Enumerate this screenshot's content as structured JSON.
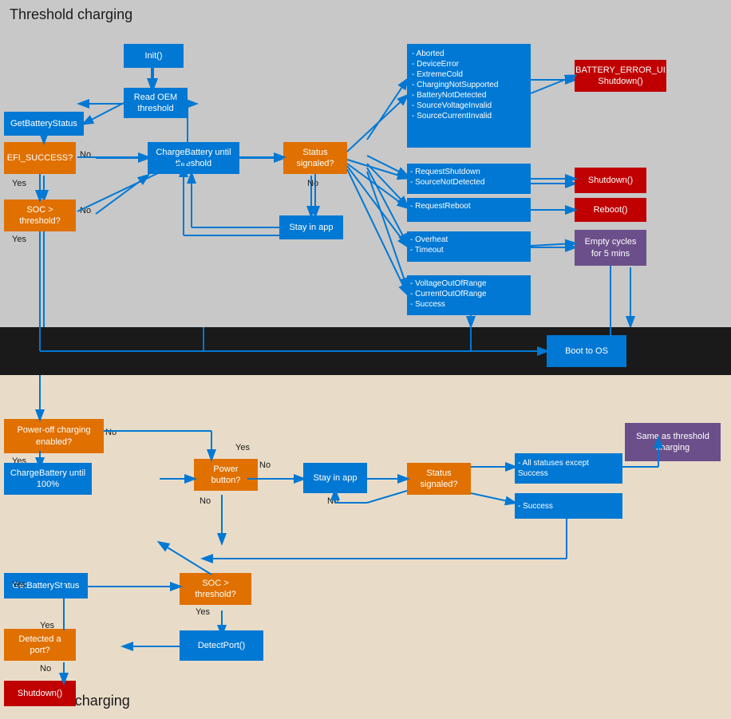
{
  "sections": {
    "top_title": "Threshold charging",
    "bottom_title": "Power-off charging"
  },
  "top_boxes": {
    "init": "Init()",
    "get_battery_status": "GetBatteryStatus",
    "read_oem": "Read OEM threshold",
    "efi_success": "EFI_SUCCESS?",
    "charge_battery_threshold": "ChargeBattery until threshold",
    "status_signaled": "Status signaled?",
    "stay_in_app_top": "Stay in app",
    "soc_threshold": "SOC > threshold?",
    "battery_error": "BATTERY_ERROR_UI Shutdown()",
    "shutdown": "Shutdown()",
    "reboot": "Reboot()",
    "empty_cycles": "Empty cycles for 5 mins",
    "aborted_group": "- Aborted\n- DeviceError\n- ExtremeCold\n- ChargingNotSupported\n- BatteryNotDetected\n- SourceVoltageInvalid\n- SourceCurrentInvalid",
    "request_shutdown": "- RequestShutdown\n- SourceNotDetected",
    "request_reboot": "- RequestReboot",
    "overheat_group": "- Overheat\n- Timeout",
    "voltage_group": "- VoltageOutOfRange\n- CurrentOutOfRange\n- Success"
  },
  "middle_boxes": {
    "boot_to_os": "Boot to OS"
  },
  "bottom_boxes": {
    "power_off_charging": "Power-off charging enabled?",
    "charge_battery_100": "ChargeBattery until 100%",
    "power_button": "Power button?",
    "stay_in_app_bot": "Stay in app",
    "status_signaled_bot": "Status signaled?",
    "get_battery_status_bot": "GetBatteryStatus",
    "soc_threshold_bot": "SOC > threshold?",
    "detected_port": "Detected a port?",
    "detect_port": "DetectPort()",
    "shutdown_bot": "Shutdown()",
    "all_statuses": "- All statuses except Success",
    "success": "- Success",
    "same_as_threshold": "Same as threshold charging"
  },
  "labels": {
    "no": "No",
    "yes": "Yes",
    "no2": "No",
    "yes2": "Yes",
    "no3": "No",
    "yes3": "Yes"
  },
  "colors": {
    "blue": "#0078d4",
    "orange": "#e07000",
    "red": "#c00000",
    "purple": "#6b4f8a",
    "arrow": "#0078d4",
    "dark_bg": "#1a1a1a",
    "top_bg": "#c8c8c8",
    "bot_bg": "#e8dcc8"
  }
}
